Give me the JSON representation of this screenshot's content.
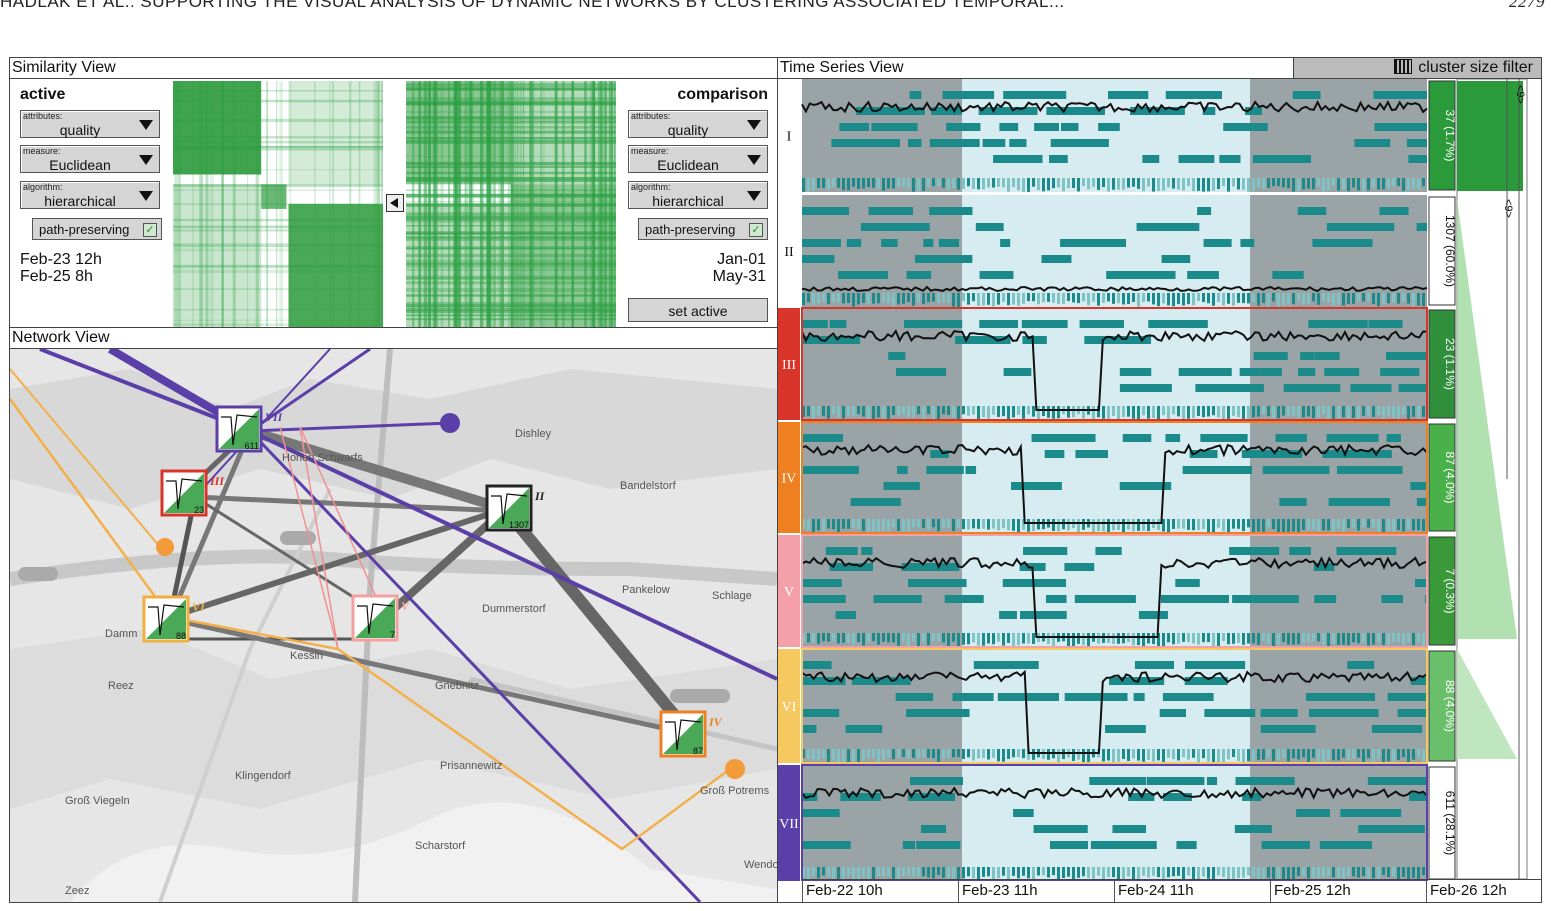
{
  "page_header": {
    "running_title": "HADLAK ET AL.: SUPPORTING THE VISUAL ANALYSIS OF DYNAMIC NETWORKS BY CLUSTERING ASSOCIATED TEMPORAL...",
    "page_number": "2279"
  },
  "similarity_view": {
    "title": "Similarity View",
    "active": {
      "heading": "active",
      "attributes_label": "attributes:",
      "attributes_value": "quality",
      "measure_label": "measure:",
      "measure_value": "Euclidean",
      "algorithm_label": "algorithm:",
      "algorithm_value": "hierarchical",
      "path_label": "path-preserving",
      "date_start": "Feb-23 12h",
      "date_end": "Feb-25 8h"
    },
    "comparison": {
      "heading": "comparison",
      "attributes_label": "attributes:",
      "attributes_value": "quality",
      "measure_label": "measure:",
      "measure_value": "Euclidean",
      "algorithm_label": "algorithm:",
      "algorithm_value": "hierarchical",
      "path_label": "path-preserving",
      "date_start": "Jan-01",
      "date_end": "May-31",
      "set_active_label": "set active"
    }
  },
  "network_view": {
    "title": "Network View",
    "places": [
      "Dishley",
      "Bandelstorf",
      "Pankelow",
      "Schlage",
      "Dummerstorf",
      "Damm",
      "Reez",
      "Kessin",
      "Gnebnitz",
      "Klingendorf",
      "Prisannewitz",
      "Groß Viegeln",
      "Groß Potrems",
      "Scharstorf",
      "Zeez",
      "Wendorf",
      "Hohen Schwarfs"
    ],
    "nodes": [
      {
        "label": "VII",
        "count": "611",
        "color": "#5b3fa8"
      },
      {
        "label": "III",
        "count": "23",
        "color": "#d8342a"
      },
      {
        "label": "II",
        "count": "1307",
        "color": "#222222"
      },
      {
        "label": "VI",
        "count": "88",
        "color": "#f0b040"
      },
      {
        "label": "V",
        "count": "7",
        "color": "#f4a0a0"
      },
      {
        "label": "IV",
        "count": "87",
        "color": "#ee8022"
      }
    ]
  },
  "time_series_view": {
    "title": "Time Series View",
    "filter_label": "cluster size filter",
    "axis_ticks": [
      "Feb-22 10h",
      "Feb-23 11h",
      "Feb-24 11h",
      "Feb-25 12h",
      "Feb-26 12h"
    ],
    "clusters": [
      {
        "id": "I",
        "size": "37 (1.7%)",
        "color": "#ffffff",
        "box_color": "#2a9a3a"
      },
      {
        "id": "II",
        "size": "1307 (60.0%)",
        "color": "#ffffff",
        "box_color": "#ffffff"
      },
      {
        "id": "III",
        "size": "23 (1.1%)",
        "color": "#d8342a",
        "box_color": "#2f8f3a"
      },
      {
        "id": "IV",
        "size": "87 (4.0%)",
        "color": "#ee8022",
        "box_color": "#4ab04a"
      },
      {
        "id": "V",
        "size": "7 (0.3%)",
        "color": "#f4a0a8",
        "box_color": "#3a9a3a"
      },
      {
        "id": "VI",
        "size": "88 (4.0%)",
        "color": "#f6c860",
        "box_color": "#6ac06a"
      },
      {
        "id": "VII",
        "size": "611 (28.1%)",
        "color": "#5b3fa8",
        "box_color": "#ffffff"
      }
    ],
    "filter_marks": [
      "<9>",
      "<9>"
    ]
  }
}
